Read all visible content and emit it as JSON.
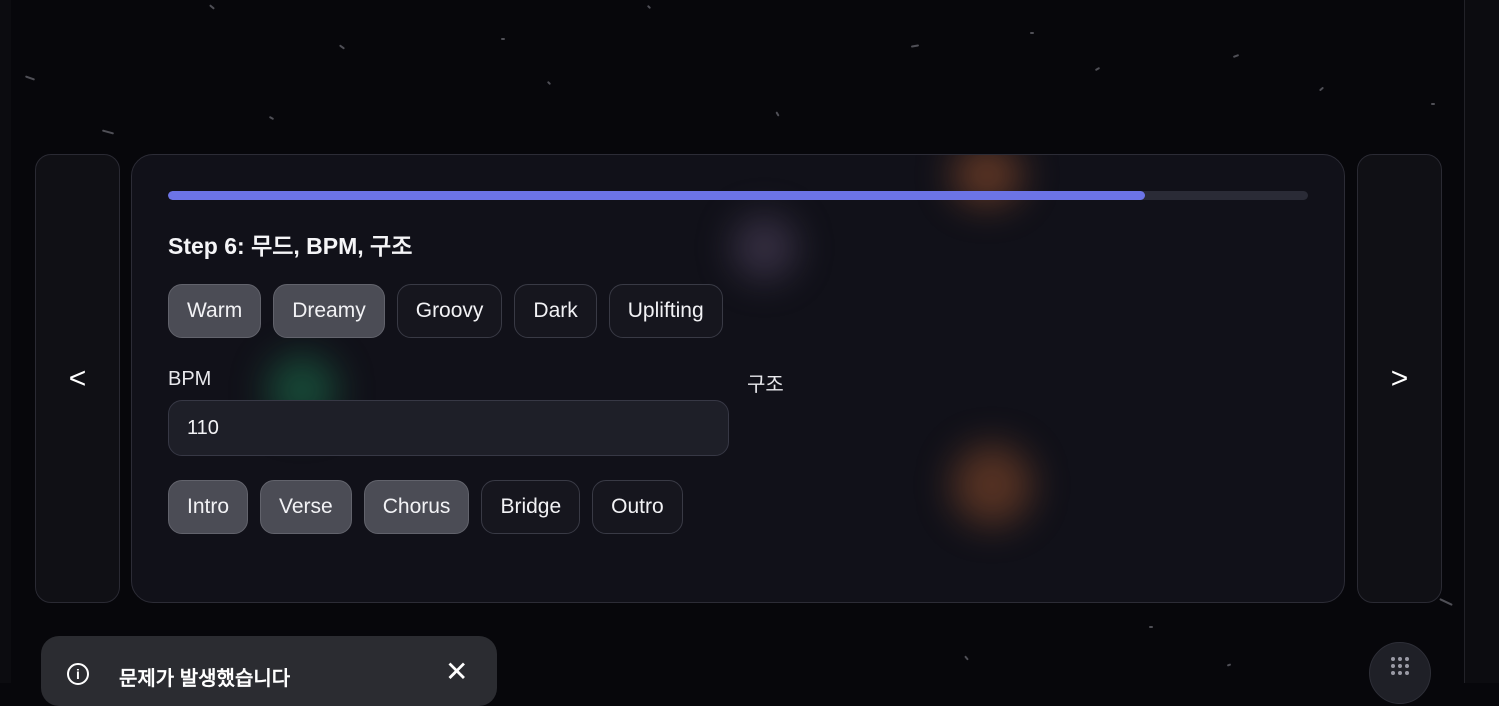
{
  "nav": {
    "prev_label": "<",
    "next_label": ">"
  },
  "wizard": {
    "progress_percent": 85.7,
    "step_title": "Step 6: 무드, BPM, 구조",
    "moods": [
      {
        "label": "Warm",
        "selected": true
      },
      {
        "label": "Dreamy",
        "selected": true
      },
      {
        "label": "Groovy",
        "selected": false
      },
      {
        "label": "Dark",
        "selected": false
      },
      {
        "label": "Uplifting",
        "selected": false
      }
    ],
    "bpm_label": "BPM",
    "bpm_value": "110",
    "structure_label": "구조",
    "sections": [
      {
        "label": "Intro",
        "selected": true
      },
      {
        "label": "Verse",
        "selected": true
      },
      {
        "label": "Chorus",
        "selected": true
      },
      {
        "label": "Bridge",
        "selected": false
      },
      {
        "label": "Outro",
        "selected": false
      }
    ]
  },
  "toast": {
    "icon": "info-icon",
    "message": "문제가 발생했습니다",
    "close_label": "✕"
  },
  "fab": {
    "icon": "grid-dots-icon"
  },
  "colors": {
    "accent": "#6c74e6",
    "background": "#07070b",
    "card": "#14141c",
    "chip_selected": "#4b4c55",
    "toast": "#2b2c31"
  }
}
